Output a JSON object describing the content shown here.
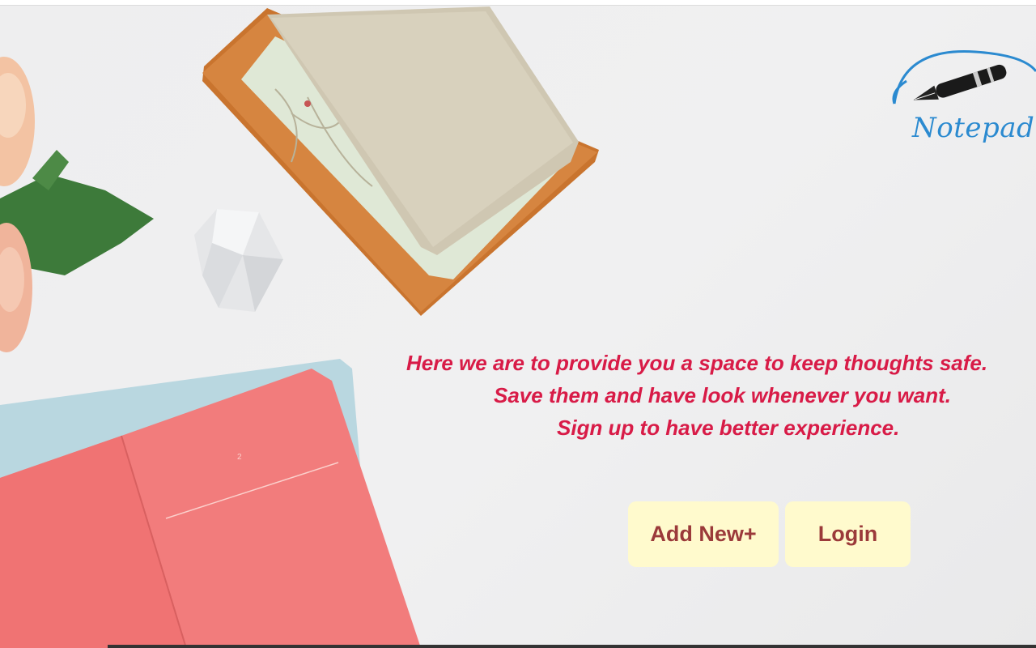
{
  "brand": {
    "logo_text": "Notepad",
    "logo_color": "#2b8ad0"
  },
  "hero": {
    "line1": "Here we are to provide you a space to keep thoughts safe.",
    "line2": "Save them and have look whenever you want.",
    "line3": "Sign up to have better experience.",
    "text_color": "#d81b47"
  },
  "actions": {
    "add_new_label": "Add New+",
    "login_label": "Login",
    "button_bg": "#fffacd",
    "button_text_color": "#9b3a3a"
  },
  "decor": {
    "notebook_page_number": "2"
  }
}
